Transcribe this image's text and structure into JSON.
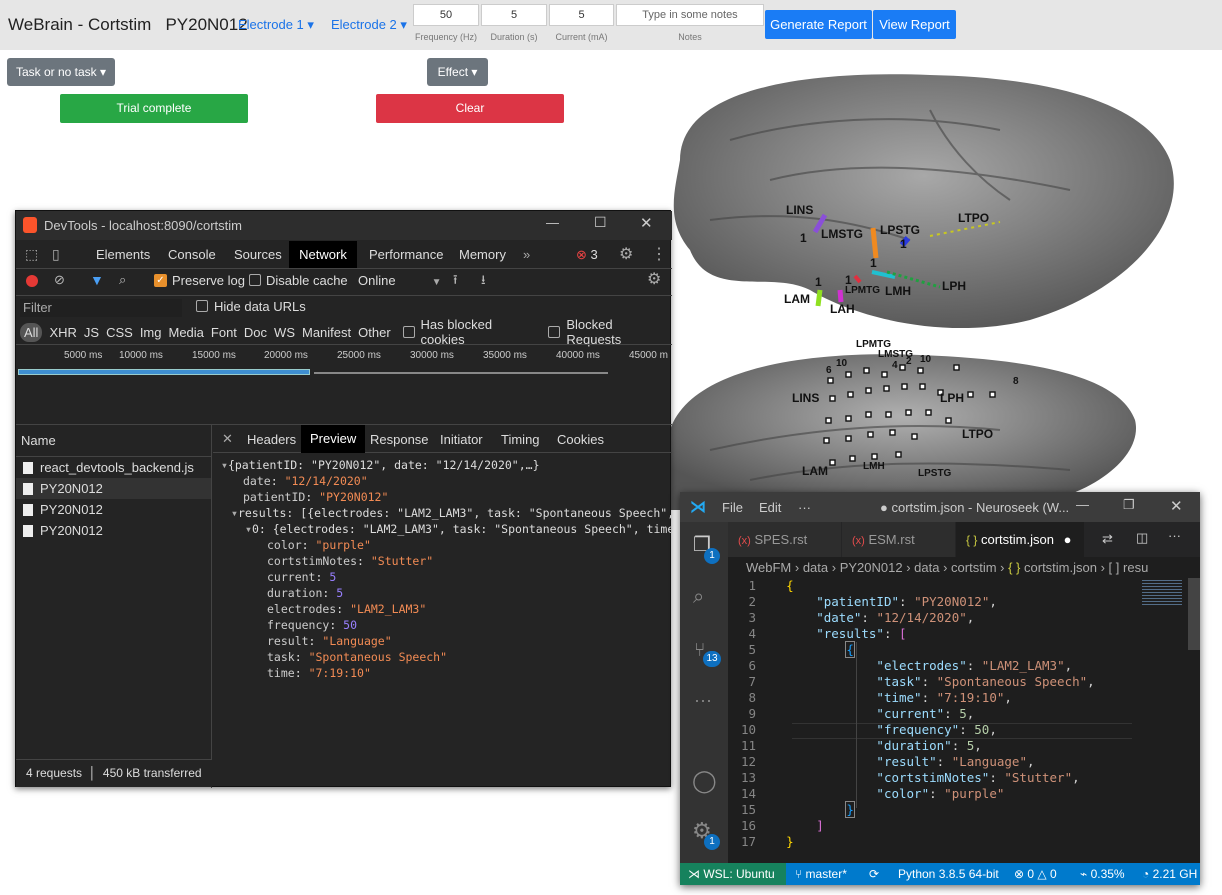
{
  "app": {
    "title": "WeBrain - Cortstim",
    "patient": "PY20N012",
    "electrode1": "Electrode 1",
    "electrode2": "Electrode 2",
    "inputs": {
      "frequency_value": "50",
      "duration_value": "5",
      "current_value": "5",
      "notes_placeholder": "Type in some notes"
    },
    "labels": {
      "frequency": "Frequency (Hz)",
      "duration": "Duration (s)",
      "current": "Current (mA)",
      "notes": "Notes"
    },
    "buttons": {
      "generate": "Generate Report",
      "view": "View Report",
      "task": "Task or no task",
      "effect": "Effect",
      "trial": "Trial complete",
      "clear": "Clear"
    }
  },
  "brain": {
    "labels": [
      "LINS",
      "LMSTG",
      "LPSTG",
      "LTPO",
      "LAM",
      "LAH",
      "LPMTG",
      "LMH",
      "LPH"
    ],
    "lower_labels": [
      "LPMTG",
      "LMSTG",
      "LINS",
      "LPH",
      "LTPO",
      "LAM",
      "LMH",
      "LPSTG",
      "LAH"
    ],
    "numbers": [
      "1",
      "6",
      "10",
      "8",
      "4",
      "2"
    ]
  },
  "devtools": {
    "title": "DevTools - localhost:8090/cortstim",
    "tabs": [
      "Elements",
      "Console",
      "Sources",
      "Network",
      "Performance",
      "Memory"
    ],
    "more": "»",
    "errors": "3",
    "toolbar": {
      "preserve": "Preserve log",
      "disable_cache": "Disable cache",
      "throttle": "Online"
    },
    "filter_placeholder": "Filter",
    "hide_urls": "Hide data URLs",
    "types": [
      "All",
      "XHR",
      "JS",
      "CSS",
      "Img",
      "Media",
      "Font",
      "Doc",
      "WS",
      "Manifest",
      "Other"
    ],
    "blocked_cookies": "Has blocked cookies",
    "blocked_requests": "Blocked Requests",
    "timeline": [
      "5000 ms",
      "10000 ms",
      "15000 ms",
      "20000 ms",
      "25000 ms",
      "30000 ms",
      "35000 ms",
      "40000 ms",
      "45000 m"
    ],
    "name_header": "Name",
    "requests": [
      "react_devtools_backend.js",
      "PY20N012",
      "PY20N012",
      "PY20N012"
    ],
    "detail_tabs": [
      "Headers",
      "Preview",
      "Response",
      "Initiator",
      "Timing",
      "Cookies"
    ],
    "status": {
      "requests": "4 requests",
      "transferred": "450 kB transferred"
    },
    "preview": {
      "root": "{patientID: \"PY20N012\", date: \"12/14/2020\",…}",
      "date_key": "date",
      "date_val": "\"12/14/2020\"",
      "pid_key": "patientID",
      "pid_val": "\"PY20N012\"",
      "results": "results: [{electrodes: \"LAM2_LAM3\", task: \"Spontaneous Speech\", t",
      "item0": "0: {electrodes: \"LAM2_LAM3\", task: \"Spontaneous Speech\", time:",
      "fields": [
        [
          "color",
          "\"purple\"",
          "s"
        ],
        [
          "cortstimNotes",
          "\"Stutter\"",
          "s"
        ],
        [
          "current",
          "5",
          "n"
        ],
        [
          "duration",
          "5",
          "n"
        ],
        [
          "electrodes",
          "\"LAM2_LAM3\"",
          "s"
        ],
        [
          "frequency",
          "50",
          "n"
        ],
        [
          "result",
          "\"Language\"",
          "s"
        ],
        [
          "task",
          "\"Spontaneous Speech\"",
          "s"
        ],
        [
          "time",
          "\"7:19:10\"",
          "s"
        ]
      ]
    }
  },
  "vscode": {
    "menu": [
      "File",
      "Edit",
      "···"
    ],
    "title": "● cortstim.json - Neuroseek (W...",
    "tabs": [
      "SPES.rst",
      "ESM.rst",
      "cortstim.json"
    ],
    "breadcrumb": [
      "WebFM",
      "data",
      "PY20N012",
      "data",
      "cortstim",
      "{ }",
      "cortstim.json",
      "[ ]",
      "resu"
    ],
    "badges": {
      "explorer": "1",
      "scm": "13",
      "settings": "1"
    },
    "status": {
      "wsl": "WSL: Ubuntu",
      "branch": "master*",
      "python": "Python 3.8.5 64-bit",
      "problems": "0",
      "warnings": "0",
      "cpu": "0.35%",
      "freq": "2.21 GH"
    },
    "code": {
      "patientID": "PY20N012",
      "date": "12/14/2020",
      "electrodes": "LAM2_LAM3",
      "task": "Spontaneous Speech",
      "time": "7:19:10",
      "current": "5",
      "frequency": "50",
      "duration": "5",
      "result": "Language",
      "cortstimNotes": "Stutter",
      "color": "purple"
    }
  }
}
